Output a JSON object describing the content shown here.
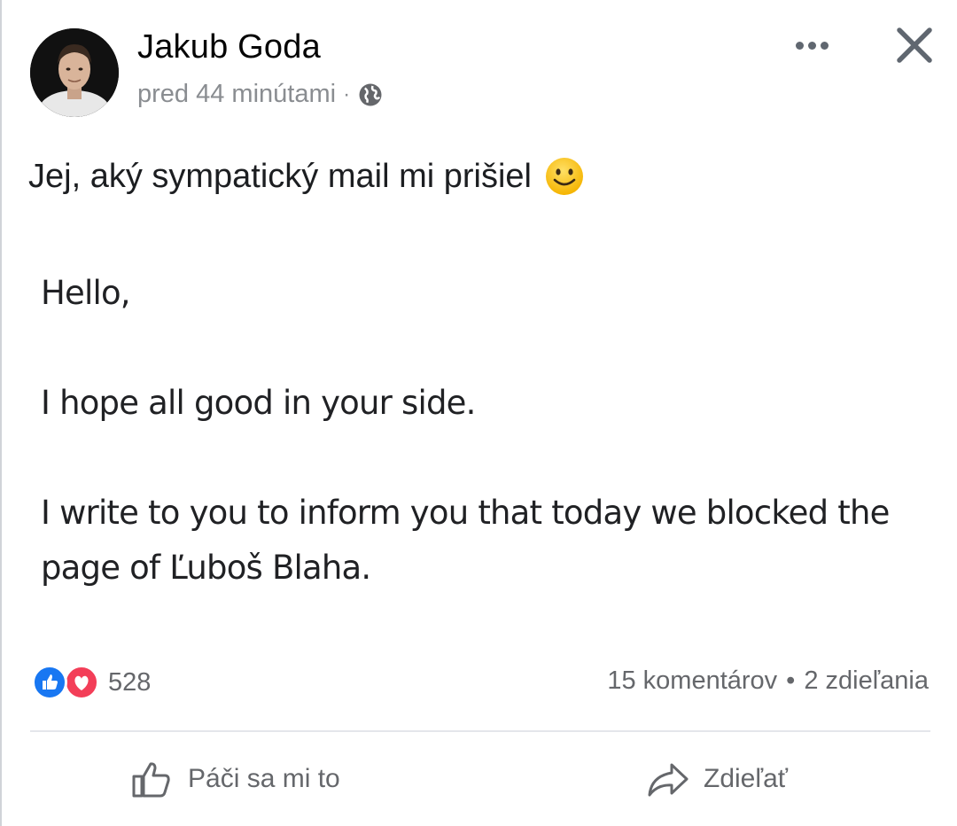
{
  "post": {
    "author": "Jakub Goda",
    "timestamp": "pred 44 minútami",
    "separator": "·",
    "audience_icon": "globe-icon",
    "text": "Jej, aký sympatický mail mi prišiel",
    "emoji": "slightly-smiling-face",
    "quoted_email": {
      "line1": "Hello,",
      "line2": "I hope all good in your side.",
      "line3": "I write to you to inform you that today we blocked the page of Ľuboš Blaha."
    }
  },
  "reactions": {
    "types": [
      "like",
      "love"
    ],
    "count": "528"
  },
  "stats": {
    "comments": "15 komentárov",
    "bullet": "•",
    "shares": "2 zdieľania"
  },
  "actions": {
    "like_label": "Páči sa mi to",
    "share_label": "Zdieľať"
  },
  "colors": {
    "like_blue": "#1877f2",
    "love_red": "#f33e58",
    "secondary_text": "#65676b"
  }
}
